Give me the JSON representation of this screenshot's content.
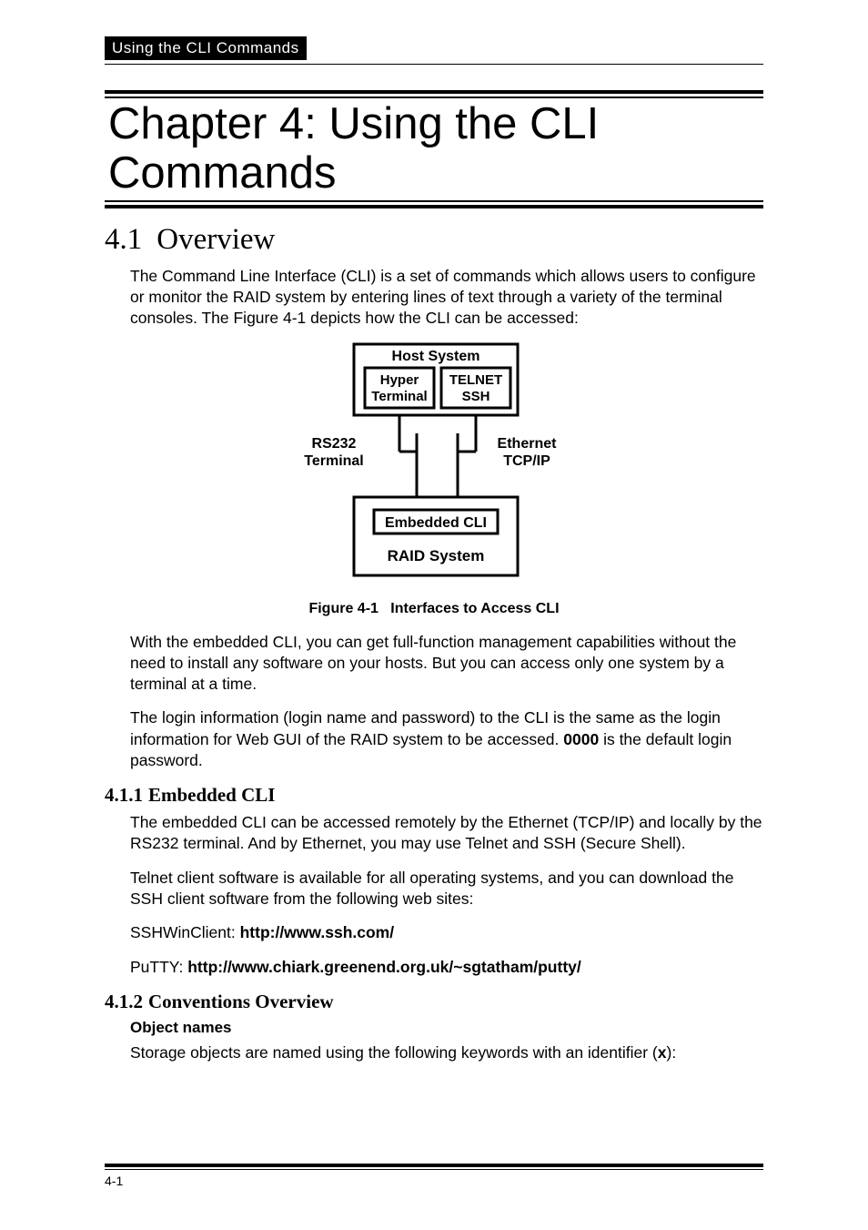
{
  "running_header": "Using the CLI Commands",
  "chapter_title": "Chapter 4: Using the CLI Commands",
  "section_4_1": {
    "num": "4.1",
    "title": "Overview",
    "p1": "The Command Line Interface (CLI) is a set of commands which allows users to configure or monitor the RAID system by entering lines of text through a variety of the terminal consoles. The Figure 4-1 depicts how the CLI can be accessed:",
    "figure": {
      "host_system": "Host System",
      "hyper_terminal_l1": "Hyper",
      "hyper_terminal_l2": "Terminal",
      "telnet": "TELNET",
      "ssh": "SSH",
      "rs232_l1": "RS232",
      "rs232_l2": "Terminal",
      "ethernet_l1": "Ethernet",
      "ethernet_l2": "TCP/IP",
      "embedded_cli": "Embedded CLI",
      "raid_system": "RAID System",
      "caption_label": "Figure 4-1",
      "caption_title": "Interfaces to Access CLI"
    },
    "p2": "With the embedded CLI, you can get full-function management capabilities without the need to install any software on your hosts. But you can access only one system by a terminal at a time.",
    "p3_a": "The login information (login name and password) to the CLI is the same as the login information for Web GUI of the RAID system to be accessed. ",
    "p3_strong": "0000",
    "p3_b": " is the default login password."
  },
  "section_4_1_1": {
    "num": "4.1.1",
    "title": "Embedded CLI",
    "p1": "The embedded CLI can be accessed remotely by the Ethernet (TCP/IP) and locally by the RS232 terminal. And by Ethernet, you may use Telnet and SSH (Secure Shell).",
    "p2": "Telnet client software is available for all operating systems, and you can download the SSH client software from the following web sites:",
    "ssh_label": "SSHWinClient: ",
    "ssh_url": "http://www.ssh.com/",
    "putty_label": "PuTTY: ",
    "putty_url": "http://www.chiark.greenend.org.uk/~sgtatham/putty/"
  },
  "section_4_1_2": {
    "num": "4.1.2",
    "title": "Conventions Overview",
    "sub1": "Object names",
    "p1_a": "Storage objects are named using the following keywords with an identifier (",
    "p1_strong": "x",
    "p1_b": "):"
  },
  "page_number": "4-1"
}
